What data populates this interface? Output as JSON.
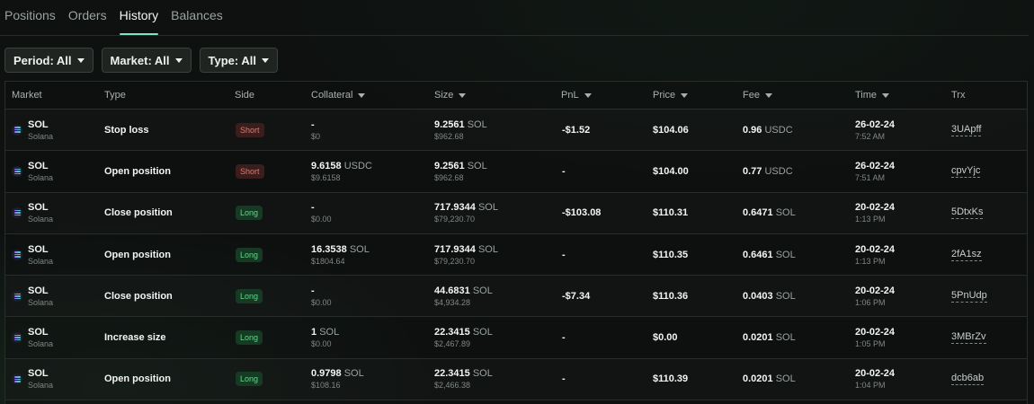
{
  "tabs": [
    "Positions",
    "Orders",
    "History",
    "Balances"
  ],
  "filters": {
    "period": "Period: All",
    "market": "Market: All",
    "type": "Type: All"
  },
  "columns": {
    "market": "Market",
    "type": "Type",
    "side": "Side",
    "collateral": "Collateral",
    "size": "Size",
    "pnl": "PnL",
    "price": "Price",
    "fee": "Fee",
    "time": "Time",
    "trx": "Trx"
  },
  "rows": [
    {
      "market": "SOL",
      "market_sub": "Solana",
      "type": "Stop loss",
      "side": "Short",
      "collateral": "-",
      "collateral_unit": "",
      "collateral_sub": "$0",
      "size": "9.2561",
      "size_unit": "SOL",
      "size_sub": "$962.68",
      "pnl": "-$1.52",
      "price": "$104.06",
      "fee": "0.96",
      "fee_unit": "USDC",
      "date": "26-02-24",
      "time": "7:52 AM",
      "trx": "3UApff"
    },
    {
      "market": "SOL",
      "market_sub": "Solana",
      "type": "Open position",
      "side": "Short",
      "collateral": "9.6158",
      "collateral_unit": "USDC",
      "collateral_sub": "$9.6158",
      "size": "9.2561",
      "size_unit": "SOL",
      "size_sub": "$962.68",
      "pnl": "-",
      "price": "$104.00",
      "fee": "0.77",
      "fee_unit": "USDC",
      "date": "26-02-24",
      "time": "7:51 AM",
      "trx": "cpvYjc"
    },
    {
      "market": "SOL",
      "market_sub": "Solana",
      "type": "Close position",
      "side": "Long",
      "collateral": "-",
      "collateral_unit": "",
      "collateral_sub": "$0.00",
      "size": "717.9344",
      "size_unit": "SOL",
      "size_sub": "$79,230.70",
      "pnl": "-$103.08",
      "price": "$110.31",
      "fee": "0.6471",
      "fee_unit": "SOL",
      "date": "20-02-24",
      "time": "1:13 PM",
      "trx": "5DtxKs"
    },
    {
      "market": "SOL",
      "market_sub": "Solana",
      "type": "Open position",
      "side": "Long",
      "collateral": "16.3538",
      "collateral_unit": "SOL",
      "collateral_sub": "$1804.64",
      "size": "717.9344",
      "size_unit": "SOL",
      "size_sub": "$79,230.70",
      "pnl": "-",
      "price": "$110.35",
      "fee": "0.6461",
      "fee_unit": "SOL",
      "date": "20-02-24",
      "time": "1:13 PM",
      "trx": "2fA1sz"
    },
    {
      "market": "SOL",
      "market_sub": "Solana",
      "type": "Close position",
      "side": "Long",
      "collateral": "-",
      "collateral_unit": "",
      "collateral_sub": "$0.00",
      "size": "44.6831",
      "size_unit": "SOL",
      "size_sub": "$4,934.28",
      "pnl": "-$7.34",
      "price": "$110.36",
      "fee": "0.0403",
      "fee_unit": "SOL",
      "date": "20-02-24",
      "time": "1:06 PM",
      "trx": "5PnUdp"
    },
    {
      "market": "SOL",
      "market_sub": "Solana",
      "type": "Increase size",
      "side": "Long",
      "collateral": "1",
      "collateral_unit": "SOL",
      "collateral_sub": "$0.00",
      "size": "22.3415",
      "size_unit": "SOL",
      "size_sub": "$2,467.89",
      "pnl": "-",
      "price": "$0.00",
      "fee": "0.0201",
      "fee_unit": "SOL",
      "date": "20-02-24",
      "time": "1:05 PM",
      "trx": "3MBrZv"
    },
    {
      "market": "SOL",
      "market_sub": "Solana",
      "type": "Open position",
      "side": "Long",
      "collateral": "0.9798",
      "collateral_unit": "SOL",
      "collateral_sub": "$108.16",
      "size": "22.3415",
      "size_unit": "SOL",
      "size_sub": "$2,466.38",
      "pnl": "-",
      "price": "$110.39",
      "fee": "0.0201",
      "fee_unit": "SOL",
      "date": "20-02-24",
      "time": "1:04 PM",
      "trx": "dcb6ab"
    }
  ]
}
